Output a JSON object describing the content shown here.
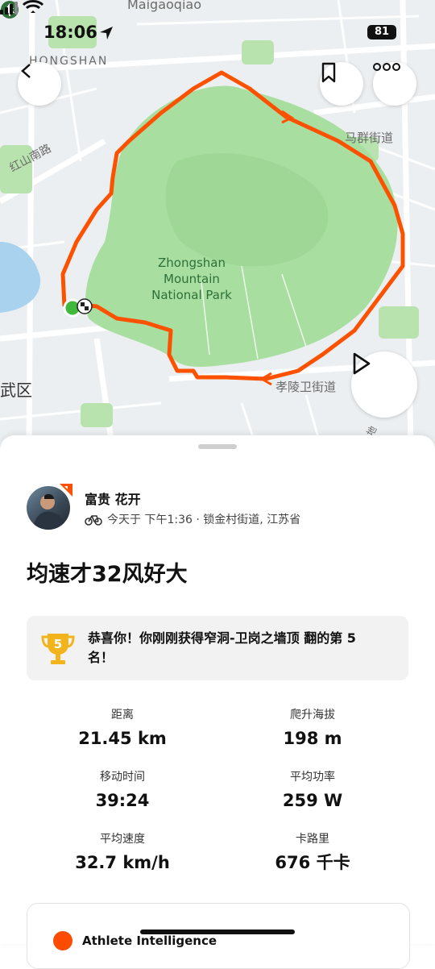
{
  "status_bar": {
    "time": "18:06",
    "battery": "81"
  },
  "map": {
    "labels": {
      "top": "Maigaoqiao",
      "top_right": "|",
      "hongshan": "HONGSHAN",
      "road_hongshan": "红山南路",
      "street_maqun": "马群街道",
      "street_xiaoling": "孝陵卫街道",
      "district": "武区",
      "small": "地"
    },
    "park_name": "Zhongshan\nMountain\nNational Park",
    "colors": {
      "route": "#fc5200",
      "park": "#a8dfa0",
      "park_dark": "#8fd08a",
      "start": "#3fb83b"
    }
  },
  "activity": {
    "user_name": "富贵 花开",
    "meta": "今天于 下午1:36 · 锁金村街道, 江苏省",
    "title": "均速才32风好大",
    "achievement": "恭喜你！你刚刚获得窄洞-卫岗之墙顶 翻的第 5 名！",
    "rank": "5",
    "stats": [
      {
        "label": "距离",
        "value": "21.45 km"
      },
      {
        "label": "爬升海拔",
        "value": "198 m"
      },
      {
        "label": "移动时间",
        "value": "39:24"
      },
      {
        "label": "平均功率",
        "value": "259 W"
      },
      {
        "label": "平均速度",
        "value": "32.7 km/h"
      },
      {
        "label": "卡路里",
        "value": "676 千卡"
      }
    ],
    "ai_card_title": "Athlete Intelligence"
  }
}
